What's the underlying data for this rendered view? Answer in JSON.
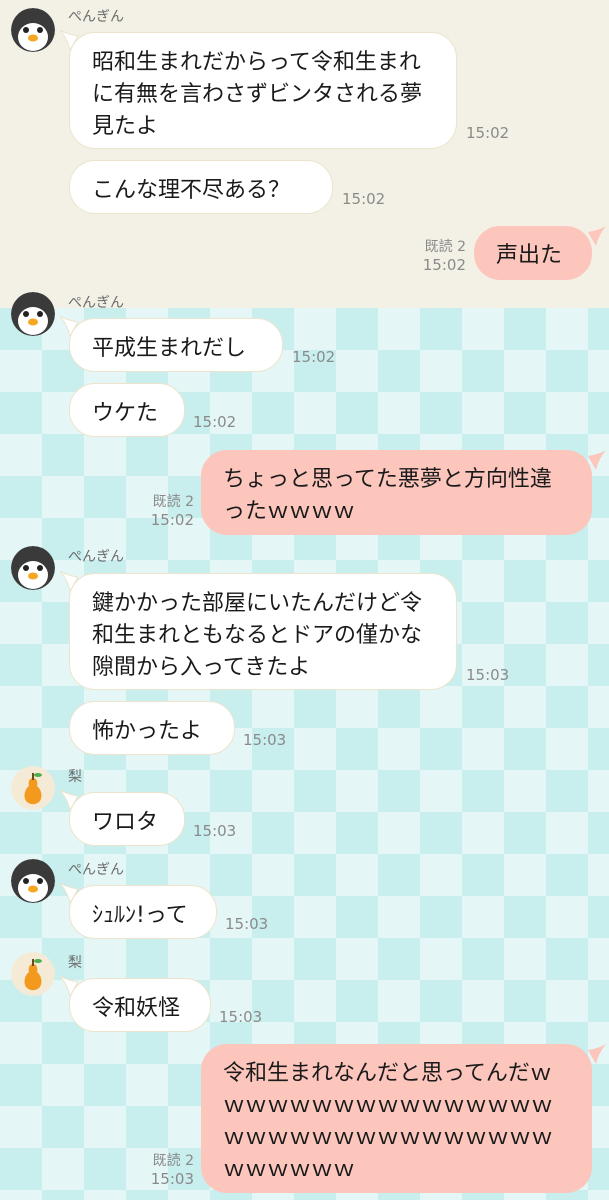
{
  "contacts": {
    "penguin": "ぺんぎん",
    "pear": "梨"
  },
  "messages": [
    {
      "text": "昭和生まれだからって令和生まれに有無を言わさずビンタされる夢見たよ",
      "time": "15:02"
    },
    {
      "text": "こんな理不尽ある？",
      "time": "15:02"
    },
    {
      "text": "声出た",
      "read": "既読 2",
      "time": "15:02"
    },
    {
      "text": "平成生まれだし",
      "time": "15:02"
    },
    {
      "text": "ウケた",
      "time": "15:02"
    },
    {
      "text": "ちょっと思ってた悪夢と方向性違ったｗｗｗｗ",
      "read": "既読 2",
      "time": "15:02"
    },
    {
      "text": "鍵かかった部屋にいたんだけど令和生まれともなるとドアの僅かな隙間から入ってきたよ",
      "time": "15:03"
    },
    {
      "text": "怖かったよ",
      "time": "15:03"
    },
    {
      "text": "ワロタ",
      "time": "15:03"
    },
    {
      "text": "ｼｭﾙﾝ!って",
      "time": "15:03"
    },
    {
      "text": "令和妖怪",
      "time": "15:03"
    },
    {
      "text": "令和生まれなんだと思ってんだｗｗｗｗｗｗｗｗｗｗｗｗｗｗｗｗｗｗｗｗｗｗｗｗｗｗｗｗｗｗｗｗｗｗｗｗｗ",
      "read": "既読 2",
      "time": "15:03"
    }
  ],
  "colors": {
    "outgoing_bubble": "#fcc6bd",
    "incoming_bubble": "#ffffff",
    "top_background": "#f3f1e6",
    "pattern_light": "#e4f7f6",
    "pattern_dark": "#c9eeee"
  }
}
